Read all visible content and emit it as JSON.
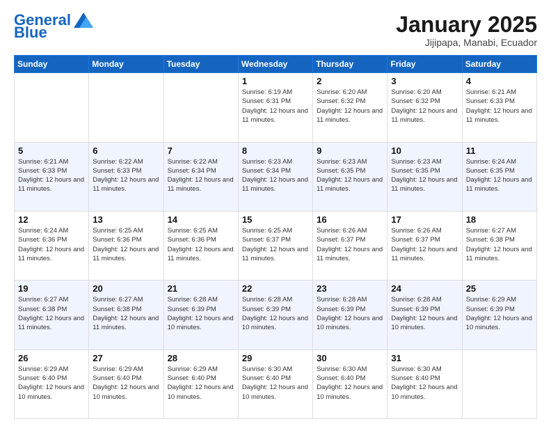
{
  "header": {
    "logo_line1": "General",
    "logo_line2": "Blue",
    "month_title": "January 2025",
    "subtitle": "Jijipapa, Manabi, Ecuador"
  },
  "days_of_week": [
    "Sunday",
    "Monday",
    "Tuesday",
    "Wednesday",
    "Thursday",
    "Friday",
    "Saturday"
  ],
  "weeks": [
    [
      {
        "day": "",
        "info": ""
      },
      {
        "day": "",
        "info": ""
      },
      {
        "day": "",
        "info": ""
      },
      {
        "day": "1",
        "info": "Sunrise: 6:19 AM\nSunset: 6:31 PM\nDaylight: 12 hours and 11 minutes."
      },
      {
        "day": "2",
        "info": "Sunrise: 6:20 AM\nSunset: 6:32 PM\nDaylight: 12 hours and 11 minutes."
      },
      {
        "day": "3",
        "info": "Sunrise: 6:20 AM\nSunset: 6:32 PM\nDaylight: 12 hours and 11 minutes."
      },
      {
        "day": "4",
        "info": "Sunrise: 6:21 AM\nSunset: 6:33 PM\nDaylight: 12 hours and 11 minutes."
      }
    ],
    [
      {
        "day": "5",
        "info": "Sunrise: 6:21 AM\nSunset: 6:33 PM\nDaylight: 12 hours and 11 minutes."
      },
      {
        "day": "6",
        "info": "Sunrise: 6:22 AM\nSunset: 6:33 PM\nDaylight: 12 hours and 11 minutes."
      },
      {
        "day": "7",
        "info": "Sunrise: 6:22 AM\nSunset: 6:34 PM\nDaylight: 12 hours and 11 minutes."
      },
      {
        "day": "8",
        "info": "Sunrise: 6:23 AM\nSunset: 6:34 PM\nDaylight: 12 hours and 11 minutes."
      },
      {
        "day": "9",
        "info": "Sunrise: 6:23 AM\nSunset: 6:35 PM\nDaylight: 12 hours and 11 minutes."
      },
      {
        "day": "10",
        "info": "Sunrise: 6:23 AM\nSunset: 6:35 PM\nDaylight: 12 hours and 11 minutes."
      },
      {
        "day": "11",
        "info": "Sunrise: 6:24 AM\nSunset: 6:35 PM\nDaylight: 12 hours and 11 minutes."
      }
    ],
    [
      {
        "day": "12",
        "info": "Sunrise: 6:24 AM\nSunset: 6:36 PM\nDaylight: 12 hours and 11 minutes."
      },
      {
        "day": "13",
        "info": "Sunrise: 6:25 AM\nSunset: 6:36 PM\nDaylight: 12 hours and 11 minutes."
      },
      {
        "day": "14",
        "info": "Sunrise: 6:25 AM\nSunset: 6:36 PM\nDaylight: 12 hours and 11 minutes."
      },
      {
        "day": "15",
        "info": "Sunrise: 6:25 AM\nSunset: 6:37 PM\nDaylight: 12 hours and 11 minutes."
      },
      {
        "day": "16",
        "info": "Sunrise: 6:26 AM\nSunset: 6:37 PM\nDaylight: 12 hours and 11 minutes."
      },
      {
        "day": "17",
        "info": "Sunrise: 6:26 AM\nSunset: 6:37 PM\nDaylight: 12 hours and 11 minutes."
      },
      {
        "day": "18",
        "info": "Sunrise: 6:27 AM\nSunset: 6:38 PM\nDaylight: 12 hours and 11 minutes."
      }
    ],
    [
      {
        "day": "19",
        "info": "Sunrise: 6:27 AM\nSunset: 6:38 PM\nDaylight: 12 hours and 11 minutes."
      },
      {
        "day": "20",
        "info": "Sunrise: 6:27 AM\nSunset: 6:38 PM\nDaylight: 12 hours and 11 minutes."
      },
      {
        "day": "21",
        "info": "Sunrise: 6:28 AM\nSunset: 6:39 PM\nDaylight: 12 hours and 10 minutes."
      },
      {
        "day": "22",
        "info": "Sunrise: 6:28 AM\nSunset: 6:39 PM\nDaylight: 12 hours and 10 minutes."
      },
      {
        "day": "23",
        "info": "Sunrise: 6:28 AM\nSunset: 6:39 PM\nDaylight: 12 hours and 10 minutes."
      },
      {
        "day": "24",
        "info": "Sunrise: 6:28 AM\nSunset: 6:39 PM\nDaylight: 12 hours and 10 minutes."
      },
      {
        "day": "25",
        "info": "Sunrise: 6:29 AM\nSunset: 6:39 PM\nDaylight: 12 hours and 10 minutes."
      }
    ],
    [
      {
        "day": "26",
        "info": "Sunrise: 6:29 AM\nSunset: 6:40 PM\nDaylight: 12 hours and 10 minutes."
      },
      {
        "day": "27",
        "info": "Sunrise: 6:29 AM\nSunset: 6:40 PM\nDaylight: 12 hours and 10 minutes."
      },
      {
        "day": "28",
        "info": "Sunrise: 6:29 AM\nSunset: 6:40 PM\nDaylight: 12 hours and 10 minutes."
      },
      {
        "day": "29",
        "info": "Sunrise: 6:30 AM\nSunset: 6:40 PM\nDaylight: 12 hours and 10 minutes."
      },
      {
        "day": "30",
        "info": "Sunrise: 6:30 AM\nSunset: 6:40 PM\nDaylight: 12 hours and 10 minutes."
      },
      {
        "day": "31",
        "info": "Sunrise: 6:30 AM\nSunset: 6:40 PM\nDaylight: 12 hours and 10 minutes."
      },
      {
        "day": "",
        "info": ""
      }
    ]
  ]
}
